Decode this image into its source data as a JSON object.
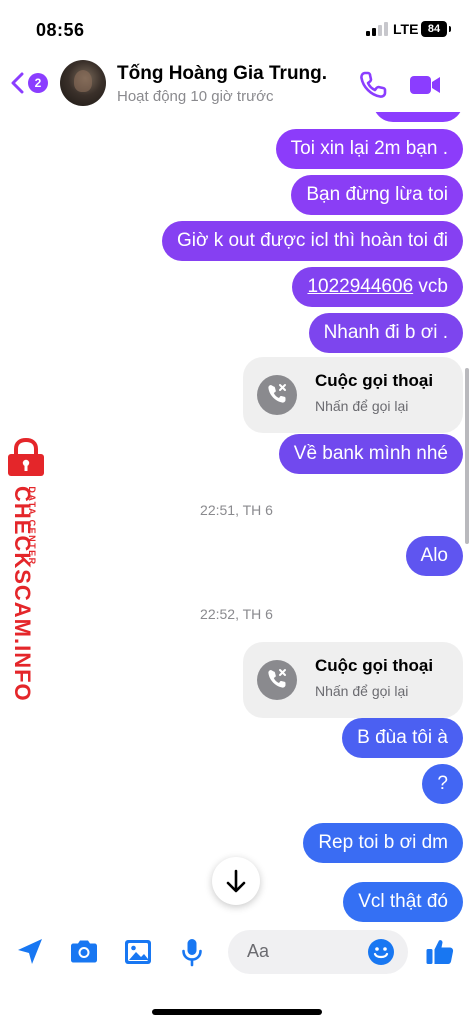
{
  "status_bar": {
    "time": "08:56",
    "network": "LTE",
    "battery": "84"
  },
  "header": {
    "back_badge": "2",
    "contact_name": "Tống Hoàng Gia Trung.",
    "contact_status": "Hoạt động 10 giờ trước",
    "icons": {
      "back": "chevron-left-icon",
      "phone": "phone-icon",
      "video": "video-camera-icon"
    }
  },
  "messages": [
    {
      "type": "sent",
      "text": "Toi xin lại 2m bạn ."
    },
    {
      "type": "sent",
      "text": "Bạn đừng lừa toi"
    },
    {
      "type": "sent",
      "text": "Giờ k out được icl thì hoàn toi đi"
    },
    {
      "type": "sent",
      "account": "1022944606",
      "bank": "vcb"
    },
    {
      "type": "sent",
      "text": "Nhanh đi b ơi ."
    },
    {
      "type": "call",
      "title": "Cuộc gọi thoại",
      "subtitle": "Nhấn để gọi lại"
    },
    {
      "type": "sent",
      "text": "Về bank mình nhé"
    },
    {
      "type": "timestamp",
      "text": "22:51, TH 6"
    },
    {
      "type": "sent",
      "text": "Alo"
    },
    {
      "type": "timestamp",
      "text": "22:52, TH 6"
    },
    {
      "type": "call",
      "title": "Cuộc gọi thoại",
      "subtitle": "Nhấn để gọi lại"
    },
    {
      "type": "sent",
      "text": "B đùa tôi à"
    },
    {
      "type": "sent",
      "text": "?"
    },
    {
      "type": "sent",
      "text": "Rep toi b ơi dm"
    },
    {
      "type": "sent",
      "text": "Vcl thật đó"
    }
  ],
  "watermark": {
    "main": "CHECKSCAM.INFO",
    "sub": "DATA CENTER"
  },
  "composer": {
    "placeholder": "Aa",
    "icons": [
      "location-arrow-icon",
      "camera-icon",
      "image-icon",
      "microphone-icon",
      "emoji-icon",
      "thumbs-up-icon"
    ]
  },
  "colors": {
    "bubble_top": "#8b3dff",
    "bubble_bottom": "#1877f2",
    "accent": "#8b3dff",
    "watermark": "#e4262a"
  }
}
